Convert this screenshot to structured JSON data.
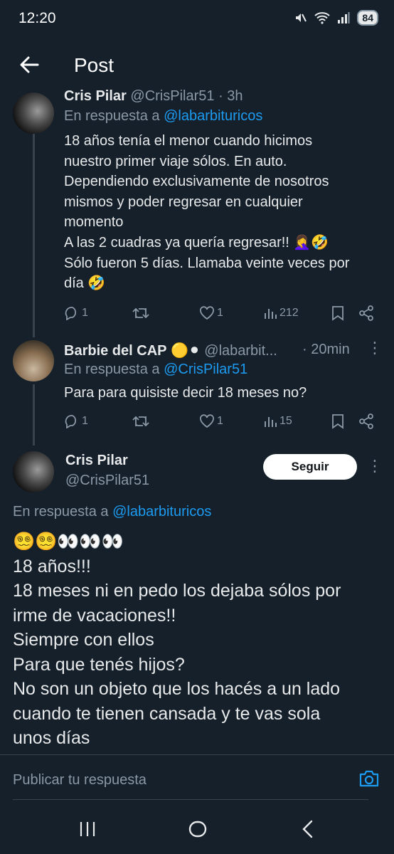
{
  "status_bar": {
    "time": "12:20",
    "battery": "84"
  },
  "header": {
    "title": "Post"
  },
  "reply1": {
    "name": "Cris Pilar",
    "handle": "@CrisPilar51",
    "time": "· 3h",
    "in_reply_prefix": "En respuesta a ",
    "in_reply_handle": "@labarbituricos",
    "text": "18 años tenía el menor cuando hicimos\nnuestro primer viaje sólos. En auto.\nDependiendo exclusivamente de nosotros\nmismos y poder regresar en cualquier\nmomento\nA las 2 cuadras ya quería regresar!! 🤦‍♀️🤣\nSólo fueron 5 días. Llamaba veinte veces por\ndía 🤣",
    "replies": "1",
    "likes": "1",
    "views": "212"
  },
  "reply2": {
    "name": "Barbie del CAP",
    "name_emoji": "🟡⚫",
    "handle": "@labarbit...",
    "time": "· 20min",
    "in_reply_prefix": "En respuesta a ",
    "in_reply_handle": "@CrisPilar51",
    "text": "Para para quisiste decir 18 meses no?",
    "replies": "1",
    "likes": "1",
    "views": "15"
  },
  "main_post": {
    "name": "Cris Pilar",
    "handle": "@CrisPilar51",
    "follow_label": "Seguir",
    "in_reply_prefix": "En respuesta a ",
    "in_reply_handle": "@labarbituricos",
    "text": "😵‍💫😵‍💫👀👀👀\n18 años!!!\n18 meses ni en pedo los dejaba sólos por\nirme de vacaciones!!\nSiempre con ellos\nPara que tenés hijos?\nNo son un objeto que los hacés a un lado\ncuando te tienen cansada y te vas sola\nunos días"
  },
  "composer": {
    "placeholder": "Publicar tu respuesta"
  },
  "colors": {
    "background": "#15202b",
    "accent": "#1d9bf0",
    "text": "#e7e9ea",
    "muted": "#8b98a5"
  }
}
